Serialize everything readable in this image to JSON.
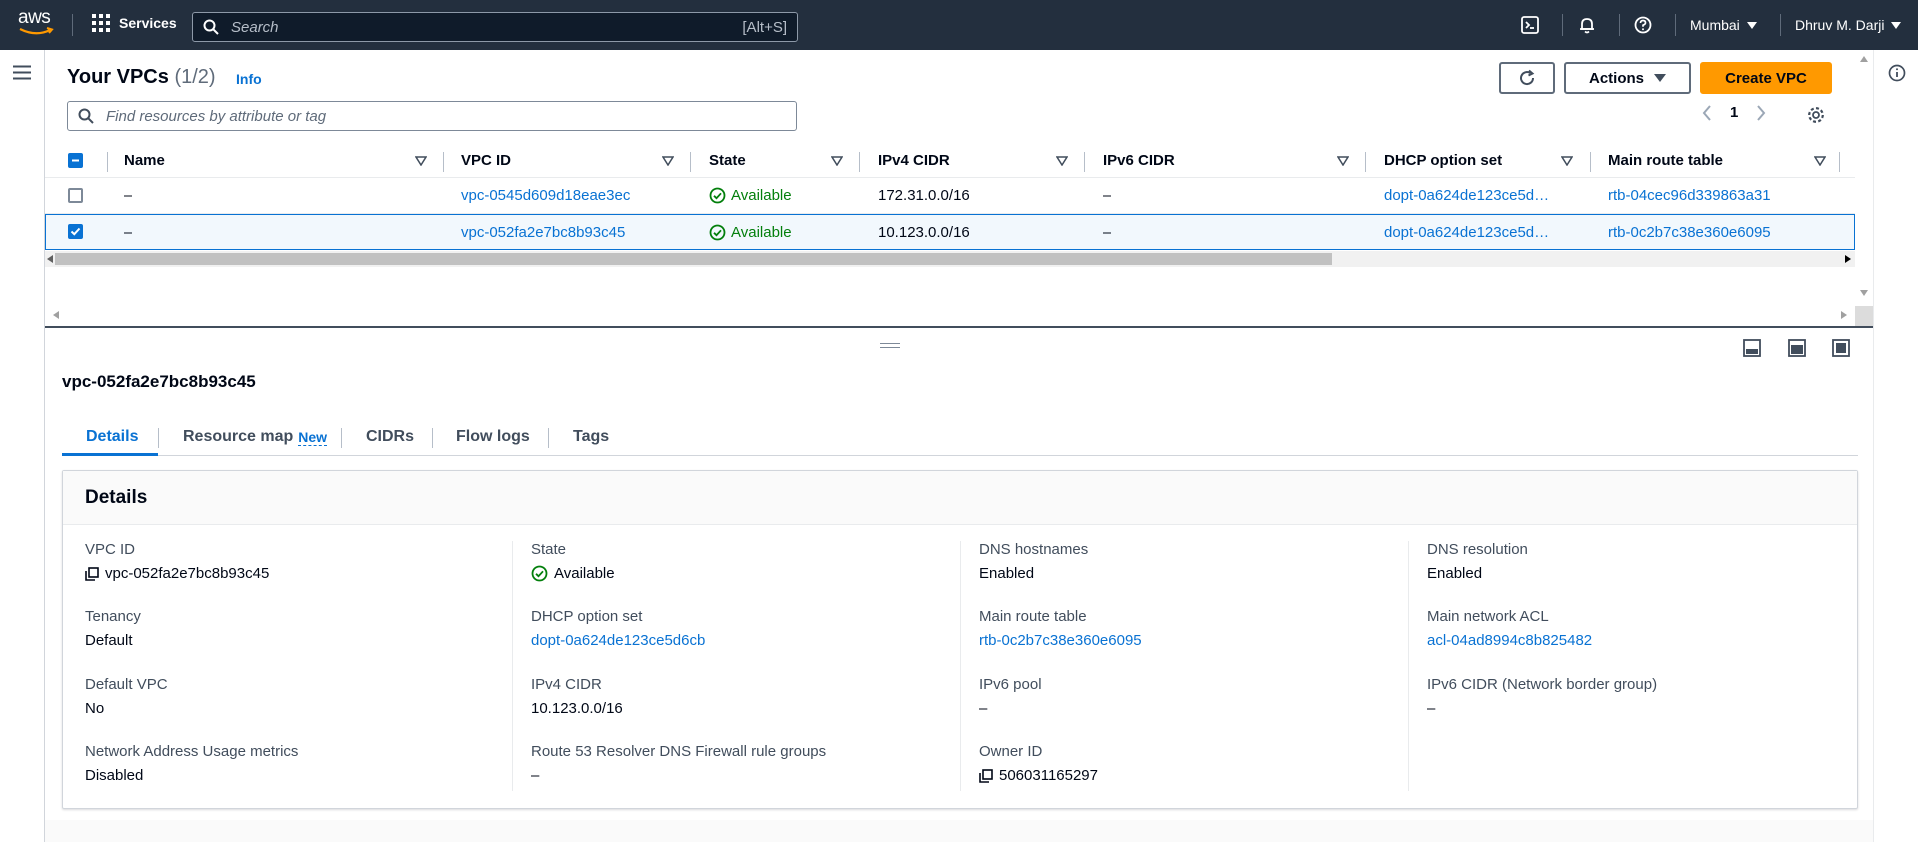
{
  "topnav": {
    "logo_text": "aws",
    "services_label": "Services",
    "search_placeholder": "Search",
    "search_shortcut": "[Alt+S]",
    "region": "Mumbai",
    "user": "Dhruv M. Darji"
  },
  "header": {
    "title": "Your VPCs",
    "count": "(1/2)",
    "info": "Info",
    "actions_label": "Actions",
    "create_label": "Create VPC",
    "filter_placeholder": "Find resources by attribute or tag",
    "page": "1"
  },
  "table": {
    "columns": [
      "Name",
      "VPC ID",
      "State",
      "IPv4 CIDR",
      "IPv6 CIDR",
      "DHCP option set",
      "Main route table"
    ],
    "rows": [
      {
        "name": "–",
        "vpc_id": "vpc-0545d609d18eae3ec",
        "state": "Available",
        "ipv4": "172.31.0.0/16",
        "ipv6": "–",
        "dhcp": "dopt-0a624de123ce5d…",
        "route_table": "rtb-04cec96d339863a31",
        "selected": false
      },
      {
        "name": "–",
        "vpc_id": "vpc-052fa2e7bc8b93c45",
        "state": "Available",
        "ipv4": "10.123.0.0/16",
        "ipv6": "–",
        "dhcp": "dopt-0a624de123ce5d…",
        "route_table": "rtb-0c2b7c38e360e6095",
        "selected": true
      }
    ]
  },
  "split_panel": {
    "title": "vpc-052fa2e7bc8b93c45",
    "tabs": [
      "Details",
      "Resource map",
      "CIDRs",
      "Flow logs",
      "Tags"
    ],
    "new_badge": "New",
    "card_title": "Details",
    "columns": [
      [
        {
          "label": "VPC ID",
          "value": "vpc-052fa2e7bc8b93c45",
          "copy": true
        },
        {
          "label": "Tenancy",
          "value": "Default"
        },
        {
          "label": "Default VPC",
          "value": "No"
        },
        {
          "label": "Network Address Usage metrics",
          "value": "Disabled"
        }
      ],
      [
        {
          "label": "State",
          "value": "Available",
          "status": true
        },
        {
          "label": "DHCP option set",
          "value": "dopt-0a624de123ce5d6cb",
          "link": true
        },
        {
          "label": "IPv4 CIDR",
          "value": "10.123.0.0/16"
        },
        {
          "label": "Route 53 Resolver DNS Firewall rule groups",
          "value": "–"
        }
      ],
      [
        {
          "label": "DNS hostnames",
          "value": "Enabled"
        },
        {
          "label": "Main route table",
          "value": "rtb-0c2b7c38e360e6095",
          "link": true
        },
        {
          "label": "IPv6 pool",
          "value": "–"
        },
        {
          "label": "Owner ID",
          "value": "506031165297",
          "copy": true
        }
      ],
      [
        {
          "label": "DNS resolution",
          "value": "Enabled"
        },
        {
          "label": "Main network ACL",
          "value": "acl-04ad8994c8b825482",
          "link": true
        },
        {
          "label": "IPv6 CIDR (Network border group)",
          "value": "–"
        }
      ]
    ]
  },
  "colors": {
    "nav_bg": "#232f3e",
    "primary_button": "#ff9900",
    "link": "#0972d3",
    "success": "#037f0c"
  },
  "icons": [
    "grid-icon",
    "search-icon",
    "cloudshell-icon",
    "bell-icon",
    "help-icon",
    "hamburger-icon",
    "info-icon",
    "refresh-icon",
    "caret-down-icon",
    "settings-icon",
    "sort-icon",
    "check-circle-icon",
    "copy-icon"
  ]
}
